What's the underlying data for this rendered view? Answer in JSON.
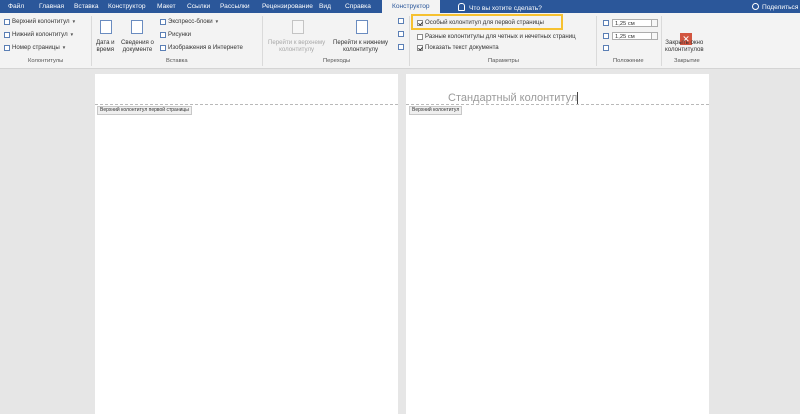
{
  "menu": {
    "tabs": [
      "Файл",
      "Главная",
      "Вставка",
      "Конструктор",
      "Макет",
      "Ссылки",
      "Рассылки",
      "Рецензирование",
      "Вид",
      "Справка"
    ],
    "active_tab": "Конструктор",
    "tell_me": "Что вы хотите сделать?",
    "share": "Поделиться"
  },
  "ribbon": {
    "header_footer": {
      "header": "Верхний колонтитул",
      "footer": "Нижний колонтитул",
      "page_number": "Номер страницы",
      "group_label": "Колонтитулы"
    },
    "insert": {
      "date_time_line1": "Дата и",
      "date_time_line2": "время",
      "doc_info_line1": "Сведения о",
      "doc_info_line2": "документе",
      "quick_parts": "Экспресс-блоки",
      "pictures": "Рисунки",
      "online_pictures": "Изображения в Интернете",
      "group_label": "Вставка"
    },
    "navigation": {
      "goto_header_line1": "Перейти к верхнему",
      "goto_header_line2": "колонтитулу",
      "goto_footer_line1": "Перейти к нижнему",
      "goto_footer_line2": "колонтитулу",
      "group_label": "Переходы"
    },
    "options": {
      "different_first_page": "Особый колонтитул для первой страницы",
      "different_odd_even": "Разные колонтитулы для четных и нечетных страниц",
      "show_document_text": "Показать текст документа",
      "group_label": "Параметры",
      "different_first_page_checked": true,
      "different_odd_even_checked": false,
      "show_document_text_checked": true
    },
    "position": {
      "header_from_top": "1,25 см",
      "footer_from_bottom": "1,25 см",
      "group_label": "Положение"
    },
    "close": {
      "label_line1": "Закрыть окно",
      "label_line2": "колонтитулов",
      "group_label": "Закрытие"
    }
  },
  "document": {
    "page1_header_tag": "Верхний колонтитул первой страницы",
    "page2_header_text": "Стандартный колонтитул",
    "page2_header_tag": "Верхний колонтитул"
  },
  "colors": {
    "menubar": "#2b579a",
    "highlight": "#f6c130",
    "close_icon": "#d2553f"
  }
}
